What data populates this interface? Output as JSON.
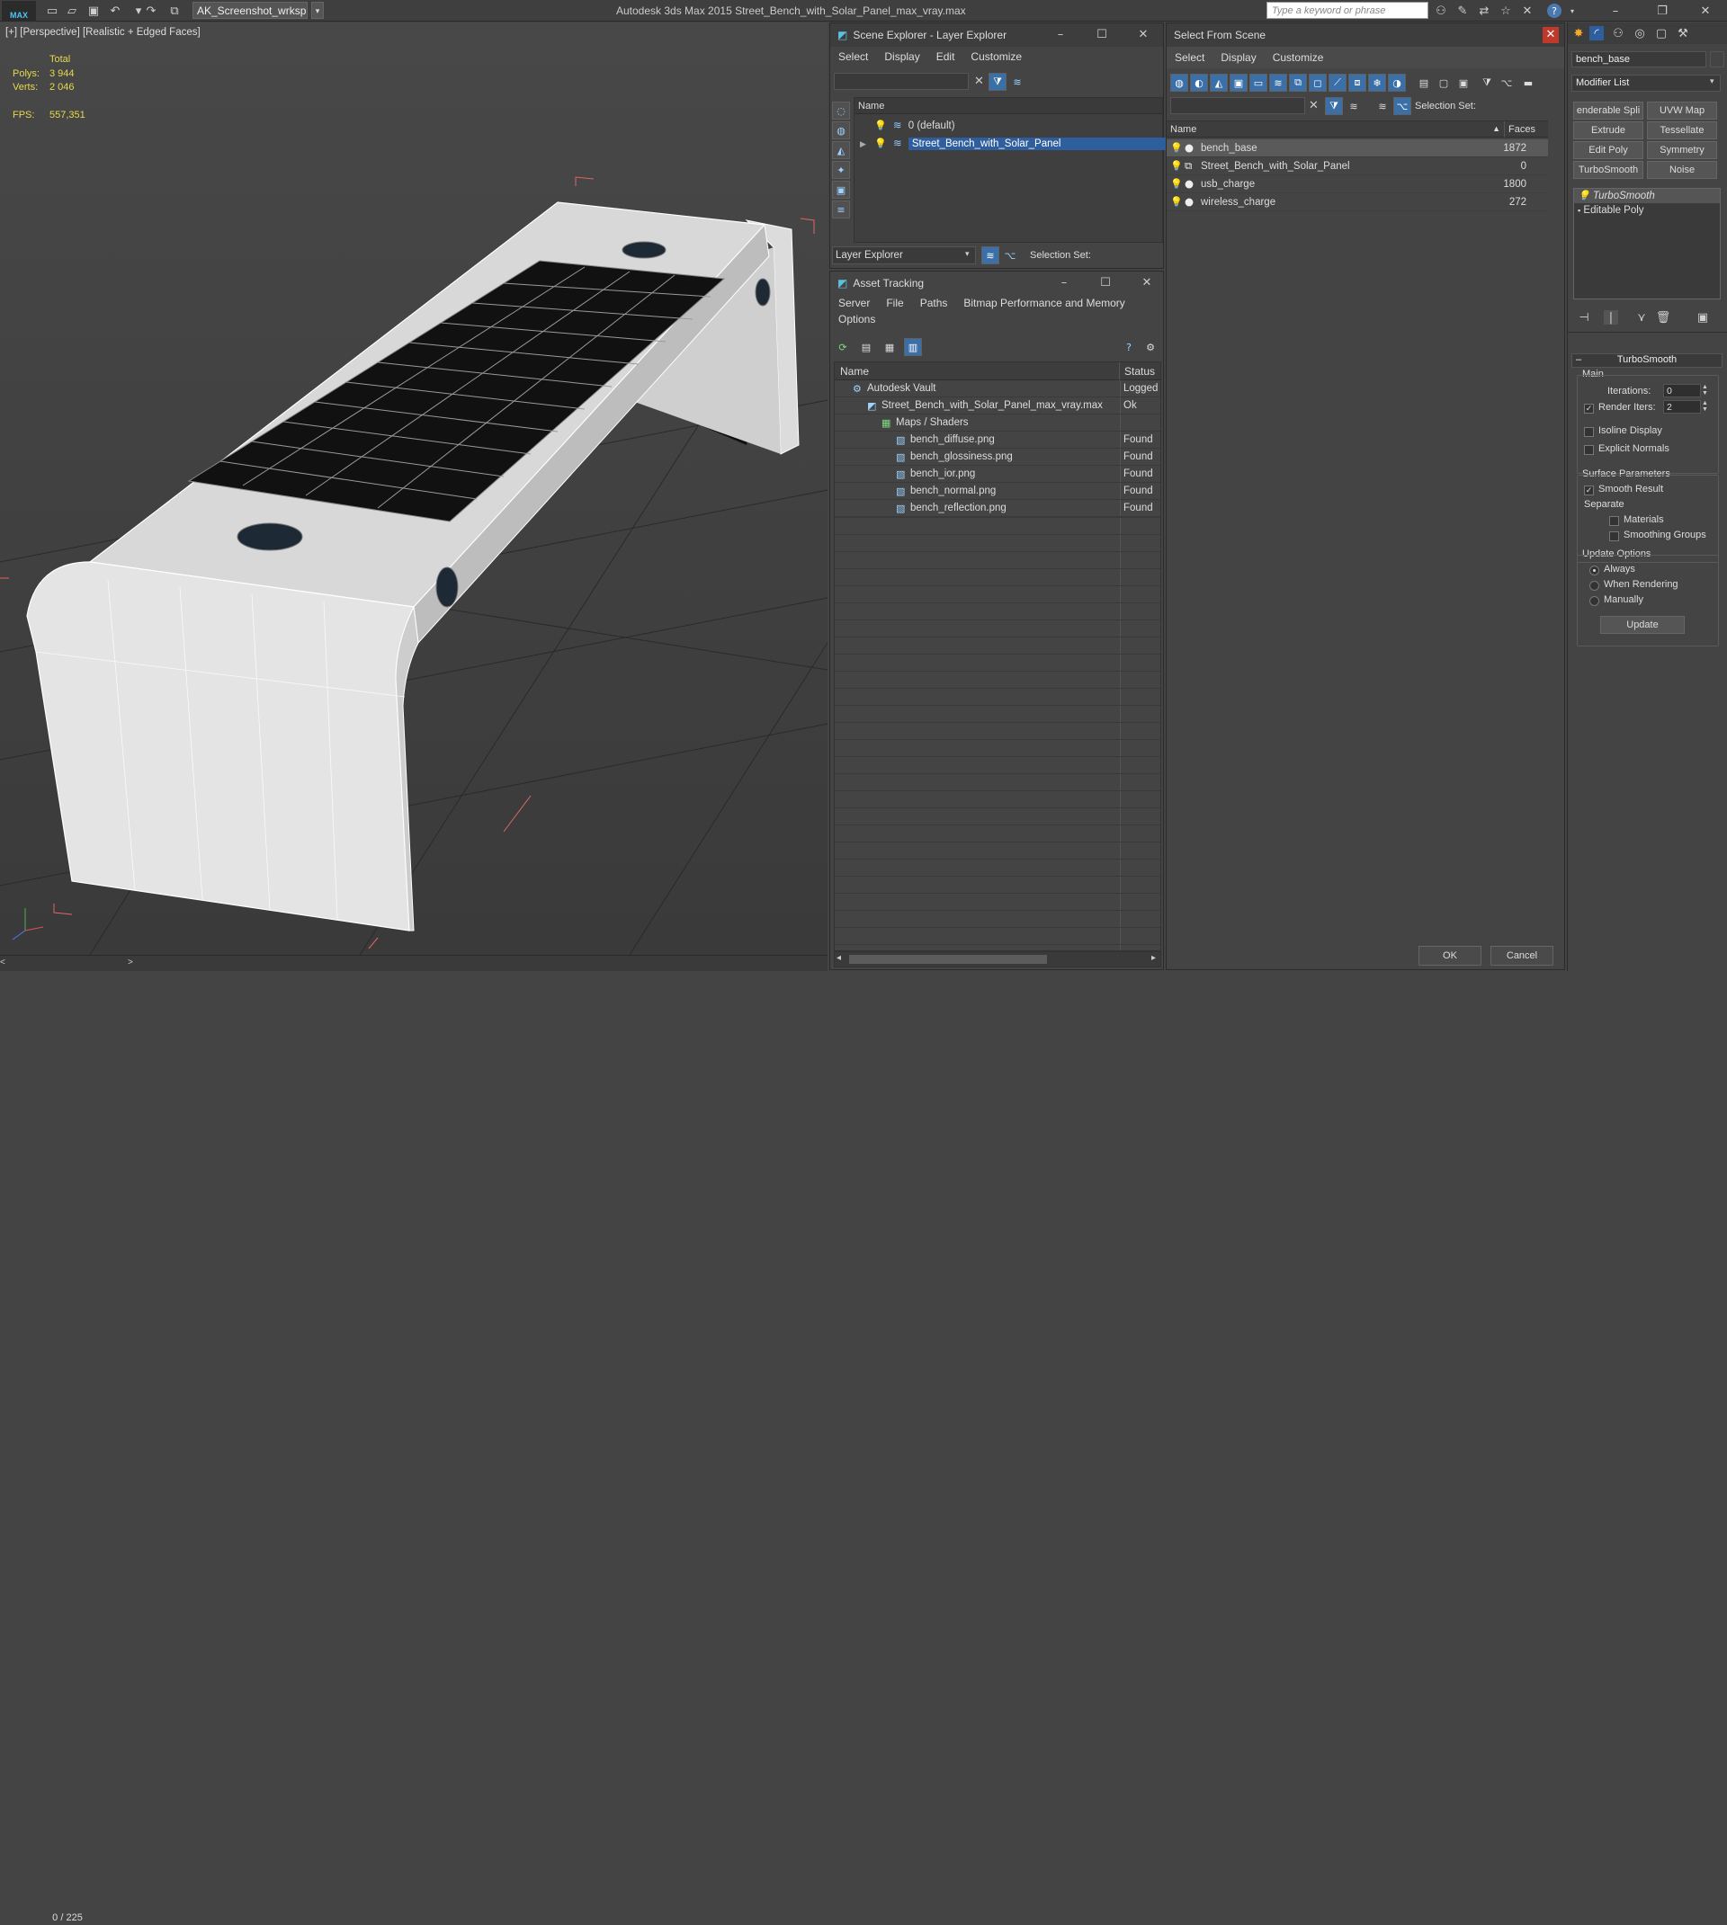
{
  "titlebar": {
    "workspace": "AK_Screenshot_wrksp",
    "app_title": "Autodesk 3ds Max  2015    Street_Bench_with_Solar_Panel_max_vray.max",
    "search_placeholder": "Type a keyword or phrase",
    "logo": "MAX"
  },
  "viewport": {
    "label": "[+] [Perspective] [Realistic + Edged Faces]",
    "stats": {
      "total_label": "Total",
      "polys_label": "Polys:",
      "polys_value": "3 944",
      "verts_label": "Verts:",
      "verts_value": "2 046",
      "fps_label": "FPS:",
      "fps_value": "557,351"
    },
    "frame_counter": "0 / 225"
  },
  "scene_explorer": {
    "title": "Scene Explorer - Layer Explorer",
    "menu": [
      "Select",
      "Display",
      "Edit",
      "Customize"
    ],
    "column_name": "Name",
    "layers": [
      {
        "name": "0 (default)",
        "selected": false
      },
      {
        "name": "Street_Bench_with_Solar_Panel",
        "selected": true
      }
    ],
    "footer_dropdown": "Layer Explorer",
    "selection_set_label": "Selection Set:"
  },
  "asset_tracking": {
    "title": "Asset Tracking",
    "menu": [
      "Server",
      "File",
      "Paths",
      "Bitmap Performance and Memory"
    ],
    "menu_row2": [
      "Options"
    ],
    "columns": [
      "Name",
      "Status"
    ],
    "rows": [
      {
        "name": "Autodesk Vault",
        "status": "Logged",
        "indent": 1
      },
      {
        "name": "Street_Bench_with_Solar_Panel_max_vray.max",
        "status": "Ok",
        "indent": 2
      },
      {
        "name": "Maps / Shaders",
        "status": "",
        "indent": 3
      },
      {
        "name": "bench_diffuse.png",
        "status": "Found",
        "indent": 4
      },
      {
        "name": "bench_glossiness.png",
        "status": "Found",
        "indent": 4
      },
      {
        "name": "bench_ior.png",
        "status": "Found",
        "indent": 4
      },
      {
        "name": "bench_normal.png",
        "status": "Found",
        "indent": 4
      },
      {
        "name": "bench_reflection.png",
        "status": "Found",
        "indent": 4
      }
    ]
  },
  "select_from_scene": {
    "title": "Select From Scene",
    "menu": [
      "Select",
      "Display",
      "Customize"
    ],
    "selection_set_label": "Selection Set:",
    "columns": [
      "Name",
      "Faces"
    ],
    "objects": [
      {
        "name": "bench_base",
        "faces": "1872",
        "selected": true
      },
      {
        "name": "Street_Bench_with_Solar_Panel",
        "faces": "0",
        "selected": false
      },
      {
        "name": "usb_charge",
        "faces": "1800",
        "selected": false
      },
      {
        "name": "wireless_charge",
        "faces": "272",
        "selected": false
      }
    ],
    "ok_label": "OK",
    "cancel_label": "Cancel"
  },
  "modify_panel": {
    "object_name": "bench_base",
    "modifier_list": "Modifier List",
    "buttons": [
      [
        "enderable Spli",
        "UVW Map"
      ],
      [
        "Extrude",
        "Tessellate"
      ],
      [
        "Edit Poly",
        "Symmetry"
      ],
      [
        "TurboSmooth",
        "Noise"
      ]
    ],
    "stack": [
      "TurboSmooth",
      "Editable Poly"
    ],
    "rollout_title": "TurboSmooth",
    "main_label": "Main",
    "iterations_label": "Iterations:",
    "iterations_value": "0",
    "render_iters_label": "Render Iters:",
    "render_iters_value": "2",
    "isoline_label": "Isoline Display",
    "explicit_normals_label": "Explicit Normals",
    "surface_params_label": "Surface Parameters",
    "smooth_result_label": "Smooth Result",
    "separate_label": "Separate",
    "materials_label": "Materials",
    "smoothing_groups_label": "Smoothing Groups",
    "update_options_label": "Update Options",
    "always_label": "Always",
    "when_rendering_label": "When Rendering",
    "manually_label": "Manually",
    "update_button": "Update"
  }
}
